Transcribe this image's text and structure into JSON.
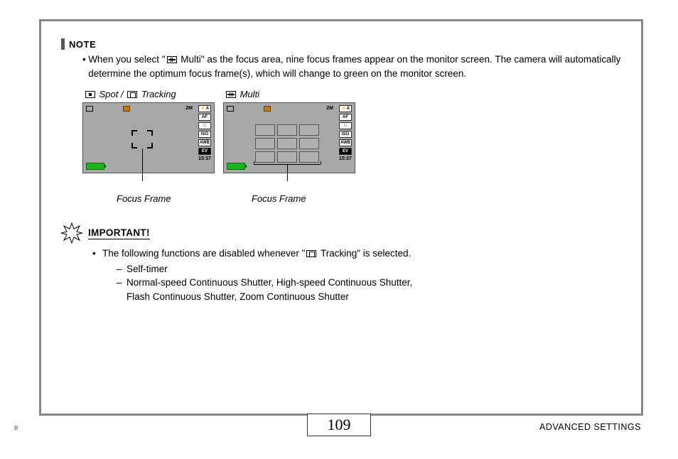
{
  "note": {
    "heading": "NOTE",
    "bullet_prefix": "When you select \"",
    "bullet_icon_label": "Multi",
    "bullet_suffix": "\" as the focus area, nine focus frames appear on the monitor screen. The camera will automatically determine the optimum focus frame(s), which will change to green on the monitor screen."
  },
  "figures": {
    "left_label_1": "Spot",
    "left_sep": " / ",
    "left_label_2": "Tracking",
    "right_label": "Multi",
    "caption_left": "Focus Frame",
    "caption_right": "Focus Frame",
    "lcd": {
      "top_right": "2M",
      "side": [
        "⚡A",
        "AF",
        "□",
        "ISO",
        "AWB",
        "EV"
      ],
      "time": "15:37"
    }
  },
  "important": {
    "heading": "IMPORTANT!",
    "intro_prefix": "The following functions are disabled whenever \"",
    "intro_suffix": " Tracking\" is selected.",
    "items": [
      "Self-timer",
      "Normal-speed Continuous Shutter, High-speed Continuous Shutter, Flash Continuous Shutter, Zoom Continuous Shutter"
    ]
  },
  "footer": {
    "page_number": "109",
    "section": "ADVANCED SETTINGS",
    "corner_mark": "B"
  }
}
